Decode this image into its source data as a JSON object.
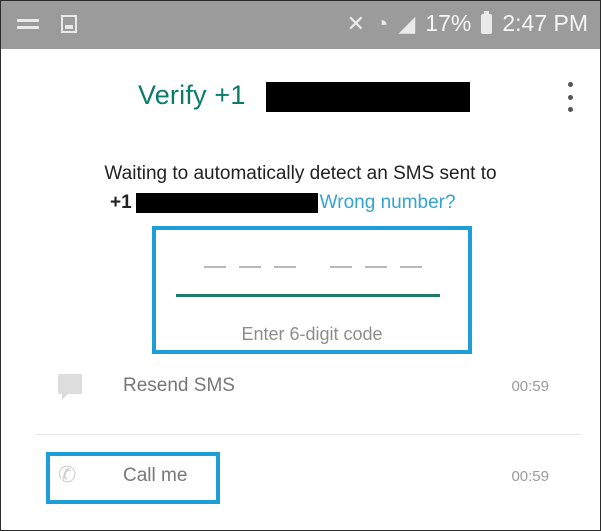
{
  "status_bar": {
    "left_icons": [
      "menu-icon",
      "gallery-icon"
    ],
    "right_icons": [
      "mute-icon",
      "wifi-icon",
      "signal-icon"
    ],
    "battery": "17%",
    "time": "2:47 PM"
  },
  "header": {
    "title": "Verify +1",
    "menu_icon": "more-vert-icon"
  },
  "instructions": {
    "line1": "Waiting to automatically detect an SMS sent to",
    "prefix": "+1",
    "wrong_number": "Wrong number?"
  },
  "code_input": {
    "hint": "Enter 6-digit code",
    "digits": 6
  },
  "actions": [
    {
      "icon": "message-icon",
      "label": "Resend SMS",
      "time": "00:59"
    },
    {
      "icon": "phone-icon",
      "label": "Call me",
      "time": "00:59"
    }
  ],
  "colors": {
    "status_bar": "#9b9b9b",
    "title_green": "#0b7b6b",
    "link_blue": "#33a3d6",
    "highlight_blue": "#1e9ed6"
  }
}
